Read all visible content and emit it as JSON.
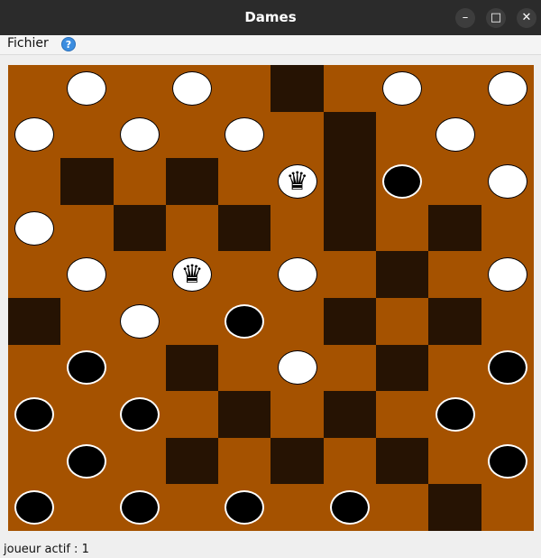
{
  "window": {
    "title": "Dames",
    "minimize_symbol": "–",
    "maximize_symbol": "□",
    "close_symbol": "✕"
  },
  "menu": {
    "fichier": "Fichier",
    "help_symbol": "?"
  },
  "board": {
    "size": 10,
    "colors": {
      "light": "#a55200",
      "dark": "#261303"
    },
    "rows": [
      ". w . w . . . w . w",
      "w . w . w . . . w .",
      ". . . . . W . b . w",
      "w . . . . . . . . .",
      ". w . W . w . . . w",
      ". . w . b . . . . .",
      ". b . . . w . . . b",
      "b . b . . . . . b .",
      ". b . . . . . . . b",
      "b . b . b . b . . ."
    ],
    "dark_squares": [
      [
        0,
        5
      ],
      [
        1,
        6
      ],
      [
        2,
        1
      ],
      [
        2,
        3
      ],
      [
        2,
        6
      ],
      [
        3,
        2
      ],
      [
        3,
        4
      ],
      [
        3,
        6
      ],
      [
        3,
        8
      ],
      [
        4,
        7
      ],
      [
        5,
        0
      ],
      [
        5,
        6
      ],
      [
        5,
        8
      ],
      [
        6,
        3
      ],
      [
        6,
        7
      ],
      [
        7,
        4
      ],
      [
        7,
        6
      ],
      [
        8,
        3
      ],
      [
        8,
        5
      ],
      [
        8,
        7
      ],
      [
        9,
        8
      ]
    ]
  },
  "status": {
    "text": "joueur actif : 1"
  }
}
